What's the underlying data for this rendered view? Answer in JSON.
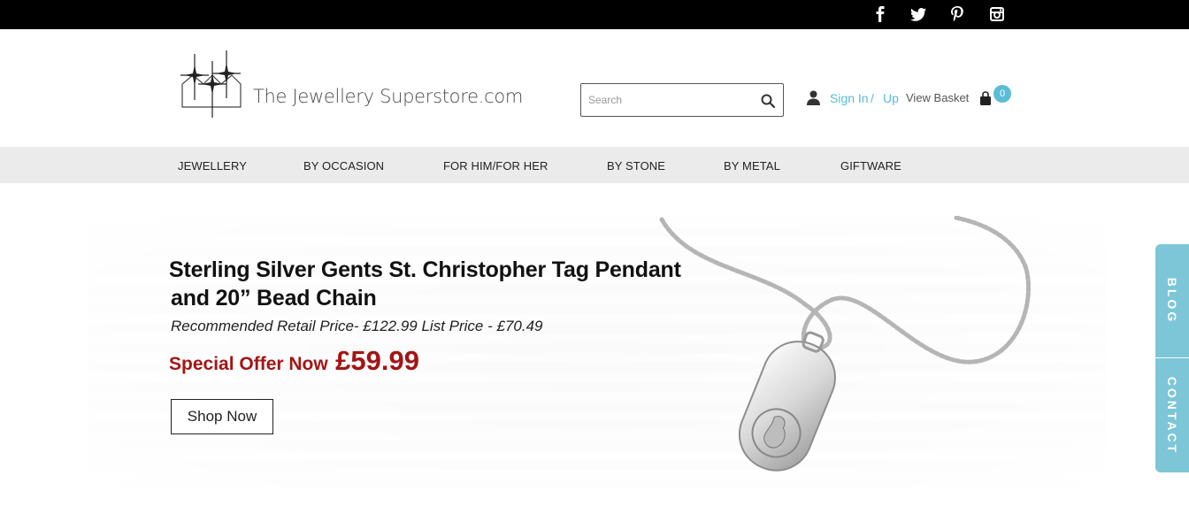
{
  "topbar": {
    "social": [
      {
        "name": "facebook-icon",
        "glyph": "f"
      },
      {
        "name": "twitter-icon",
        "glyph": "t"
      },
      {
        "name": "pinterest-icon",
        "glyph": "p"
      },
      {
        "name": "instagram-icon",
        "glyph": "i"
      }
    ]
  },
  "header": {
    "logo_text": "The Jewellery Superstore.com",
    "search_placeholder": "Search",
    "sign_in": "Sign In",
    "separator": "/",
    "sign_up": "Up",
    "view_basket": "View Basket",
    "basket_count": "0"
  },
  "nav": {
    "items": [
      "JEWELLERY",
      "BY OCCASION",
      "FOR HIM/FOR HER",
      "BY STONE",
      "BY METAL",
      "GIFTWARE"
    ]
  },
  "hero": {
    "title_line1": "Sterling Silver Gents St. Christopher Tag Pendant",
    "title_line2": "and 20” Bead Chain",
    "rrp": "Recommended Retail Price- £122.99 List Price - £70.49",
    "offer_label": "Special Offer Now",
    "offer_price": "£59.99",
    "cta": "Shop Now"
  },
  "side_tabs": {
    "blog": "BLOG",
    "contact": "CONTACT"
  },
  "colors": {
    "accent": "#5bbcd6",
    "side_tab": "#7cc6d8",
    "offer": "#a31515",
    "topbar": "#000000",
    "nav_bg": "#ebebeb"
  }
}
